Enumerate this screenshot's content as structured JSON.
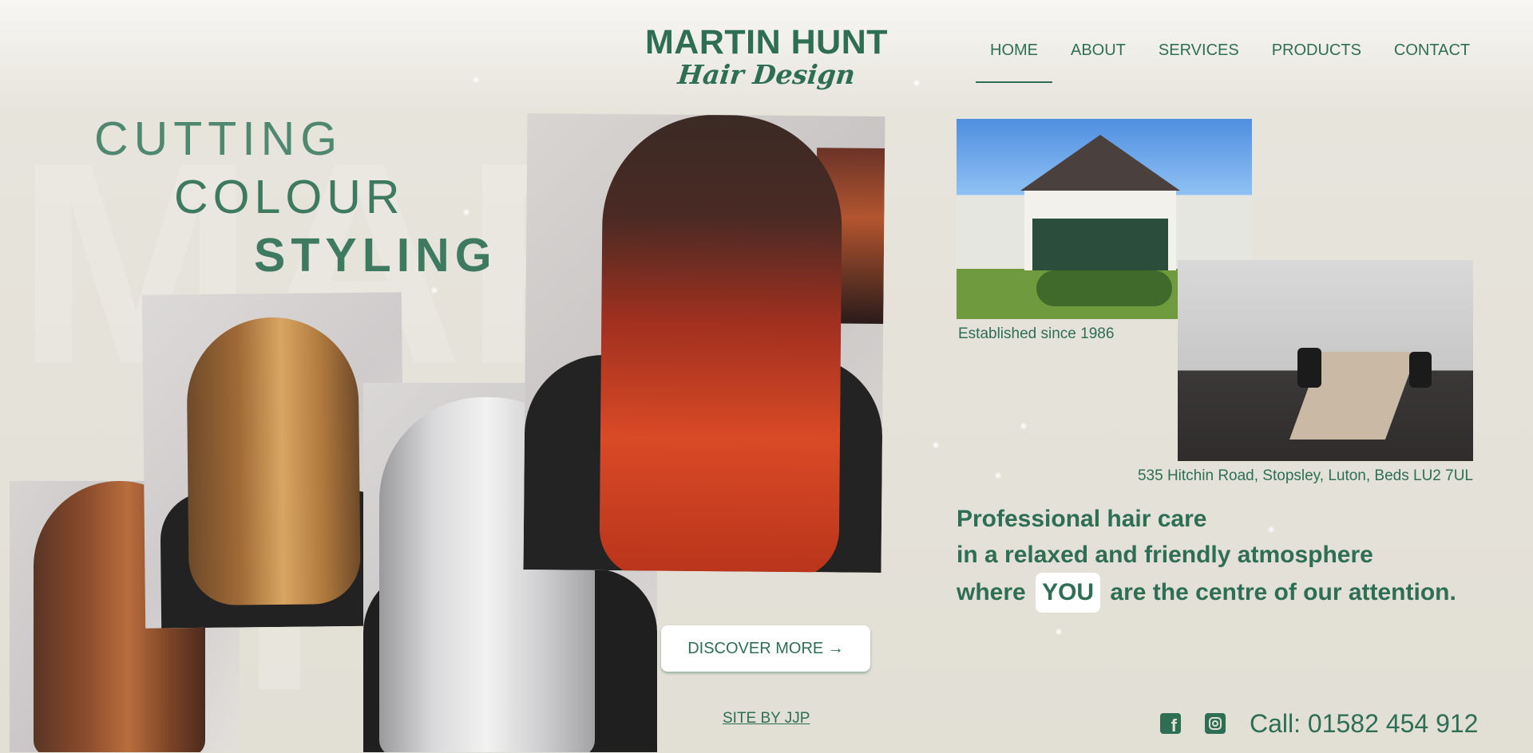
{
  "brand": {
    "name": "MARTIN HUNT",
    "tagline": "Hair Design"
  },
  "nav": {
    "items": [
      {
        "label": "HOME",
        "active": true
      },
      {
        "label": "ABOUT",
        "active": false
      },
      {
        "label": "SERVICES",
        "active": false
      },
      {
        "label": "PRODUCTS",
        "active": false
      },
      {
        "label": "CONTACT",
        "active": false
      }
    ]
  },
  "headline": {
    "line1": "CUTTING",
    "line2": "COLOUR",
    "line3": "STYLING"
  },
  "salon": {
    "established": "Established since 1986",
    "address": "535 Hitchin Road, Stopsley, Luton, Beds LU2 7UL"
  },
  "tagline": {
    "line1": "Professional hair care",
    "line2": "in a relaxed and friendly atmosphere",
    "line3_before": "where",
    "line3_highlight": "YOU",
    "line3_after": "are the centre of our attention."
  },
  "cta": {
    "discover_label": "DISCOVER MORE →"
  },
  "footer": {
    "credit": "SITE BY JJP",
    "social": [
      "facebook-icon",
      "instagram-icon"
    ],
    "call": "Call: 01582 454 912"
  },
  "colors": {
    "brand_green": "#2e6e55",
    "background": "#e2dfd5",
    "button_bg": "#ffffff"
  }
}
